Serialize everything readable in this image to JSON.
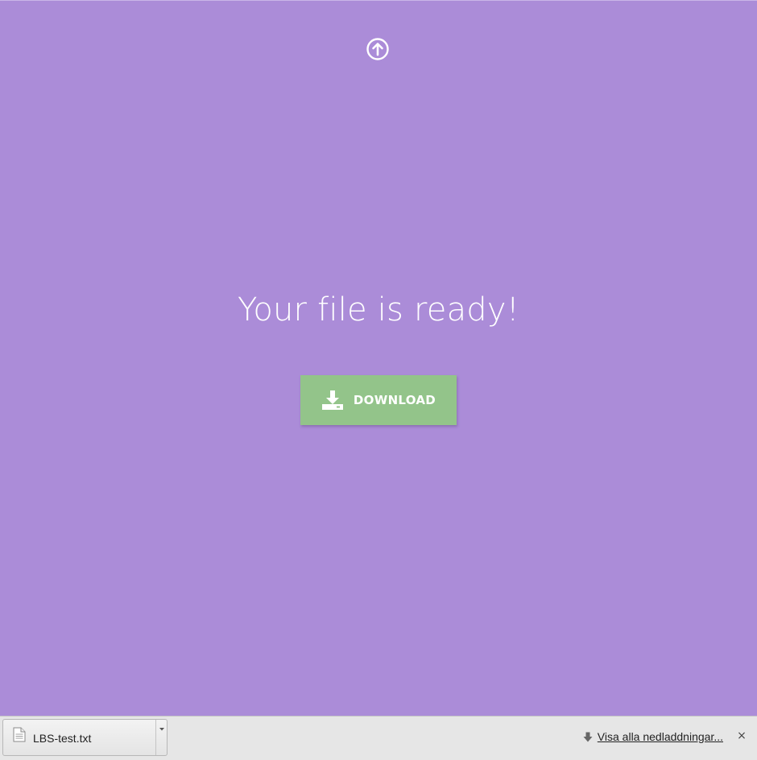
{
  "page": {
    "background_color": "#ab8cd8",
    "top_icon": "arrow-up-circle-icon",
    "headline": "Your file is ready!",
    "download_button": {
      "label": "DOWNLOAD",
      "icon": "download-tray-icon",
      "color": "#93c48a"
    }
  },
  "download_shelf": {
    "items": [
      {
        "file_name": "LBS-test.txt",
        "icon": "text-file-icon"
      }
    ],
    "show_all": {
      "label": "Visa alla nedladdningar...",
      "icon": "download-arrow-icon"
    },
    "close_icon": "close-icon",
    "close_glyph": "×"
  }
}
